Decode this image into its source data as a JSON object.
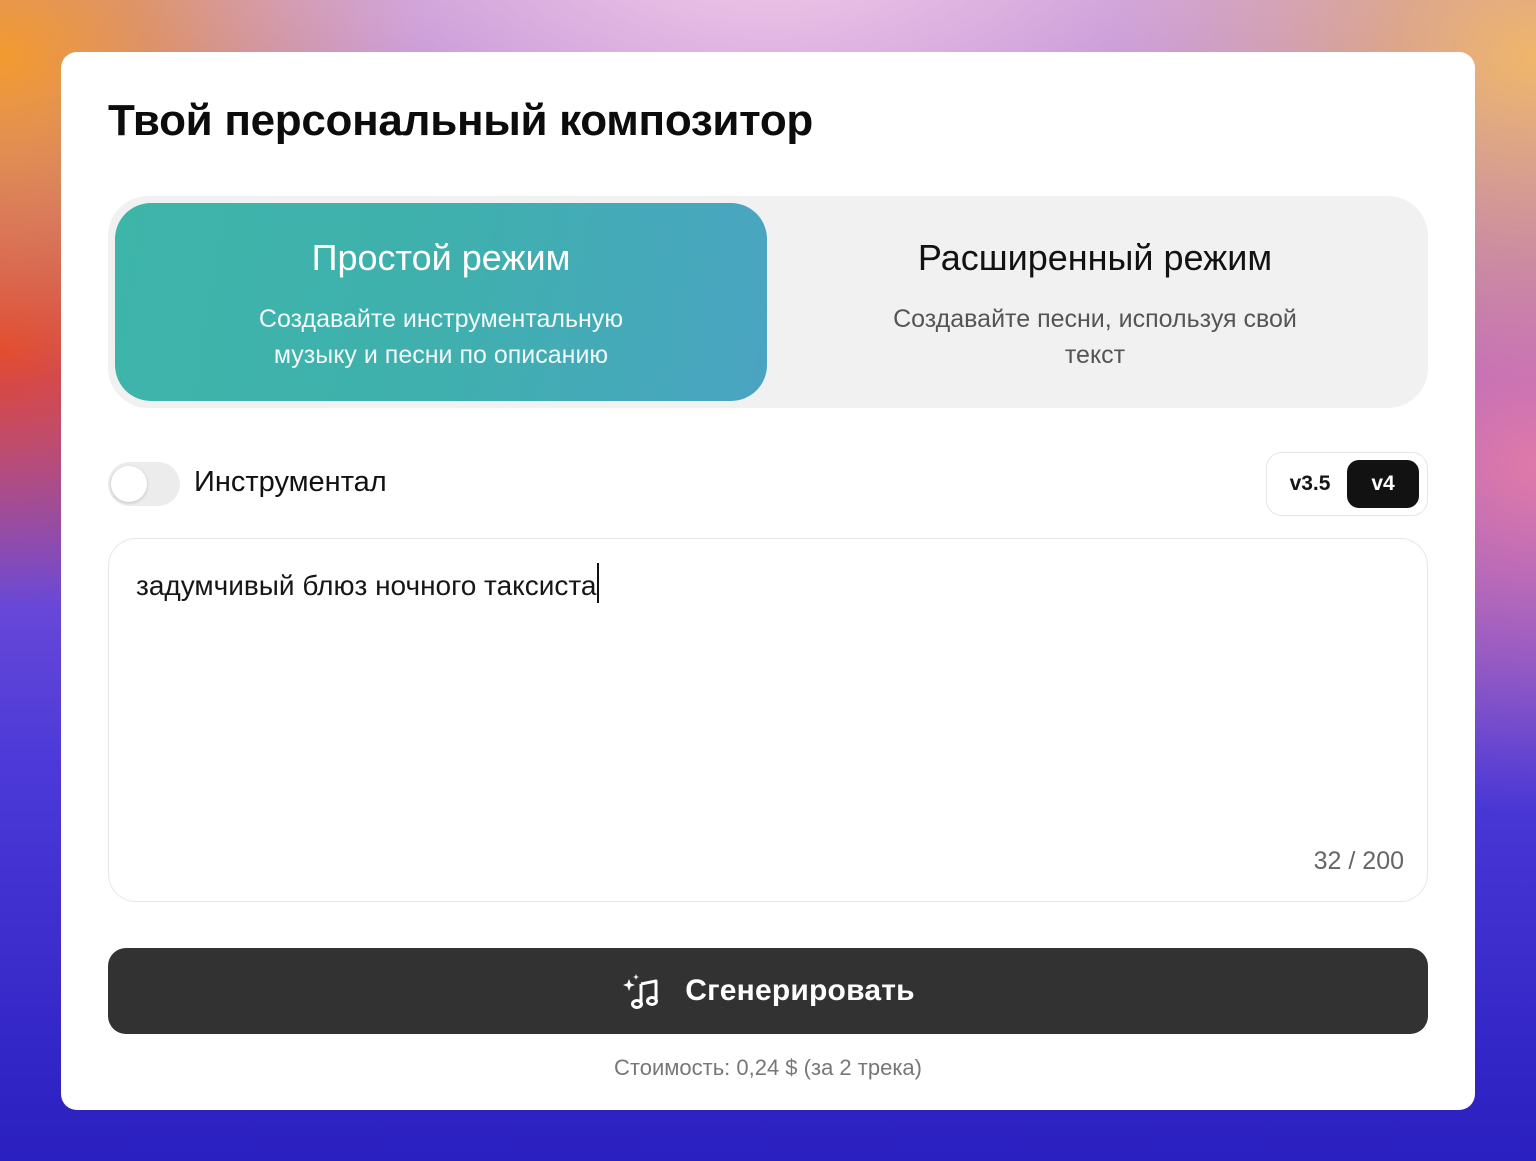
{
  "header": {
    "title": "Твой персональный композитор"
  },
  "modes": [
    {
      "title": "Простой режим",
      "description": "Создавайте инструментальную музыку и песни по описанию",
      "active": true
    },
    {
      "title": "Расширенный режим",
      "description": "Создавайте песни, используя свой текст",
      "active": false
    }
  ],
  "instrumental": {
    "label": "Инструментал",
    "enabled": false
  },
  "versions": {
    "options": [
      "v3.5",
      "v4"
    ],
    "selected": "v4"
  },
  "prompt": {
    "value": "задумчивый блюз ночного таксиста",
    "counter": "32 / 200"
  },
  "generate": {
    "label": "Сгенерировать",
    "icon": "sparkle-music-note-icon"
  },
  "cost": {
    "text": "Стоимость: 0,24 $ (за 2 трека)"
  },
  "colors": {
    "simple_mode_accent": "#3fb0ad",
    "generate_button": "#323232",
    "selected_version": "#121212"
  }
}
